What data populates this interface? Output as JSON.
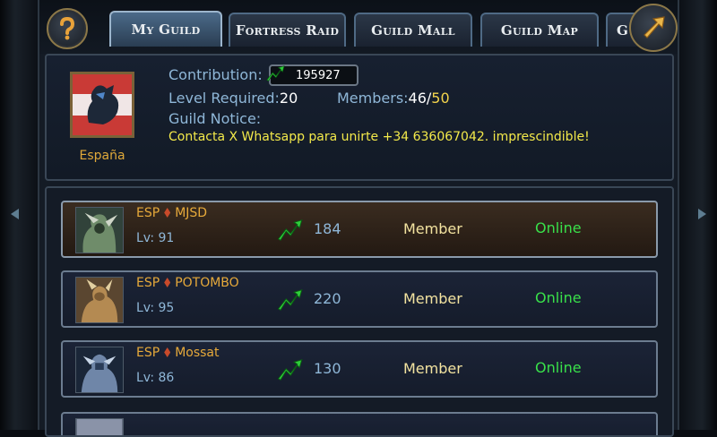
{
  "tabs": [
    {
      "label": "My Guild",
      "active": true
    },
    {
      "label": "Fortress Raid",
      "active": false
    },
    {
      "label": "Guild Mall",
      "active": false
    },
    {
      "label": "Guild Map",
      "active": false
    },
    {
      "label": "G",
      "active": false
    }
  ],
  "guild": {
    "name": "España",
    "contribution_label": "Contribution:",
    "contribution_value": "195927",
    "level_label": "Level Required:",
    "level_value": "20",
    "members_label": "Members:",
    "members_current": "46",
    "members_sep": "/",
    "members_max": "50",
    "notice_label": "Guild Notice:",
    "notice_text": "Contacta X Whatsapp para unirte +34 636067042. imprescindible!"
  },
  "members": [
    {
      "tag": "ESP",
      "name": "MJSD",
      "level": "Lv: 91",
      "contribution": "184",
      "role": "Member",
      "status": "Online",
      "selected": true
    },
    {
      "tag": "ESP",
      "name": "POTOMBO",
      "level": "Lv: 95",
      "contribution": "220",
      "role": "Member",
      "status": "Online",
      "selected": false
    },
    {
      "tag": "ESP",
      "name": "Mossat",
      "level": "Lv: 86",
      "contribution": "130",
      "role": "Member",
      "status": "Online",
      "selected": false
    }
  ],
  "colors": {
    "online": "#39e04a",
    "name_gold": "#e6a93a",
    "notice_yellow": "#f3e94a",
    "label_blue": "#8fb7d8"
  },
  "icons": {
    "help": "question-mark-icon",
    "back": "return-arrow-icon",
    "contribution": "green-up-arrow-icon"
  }
}
